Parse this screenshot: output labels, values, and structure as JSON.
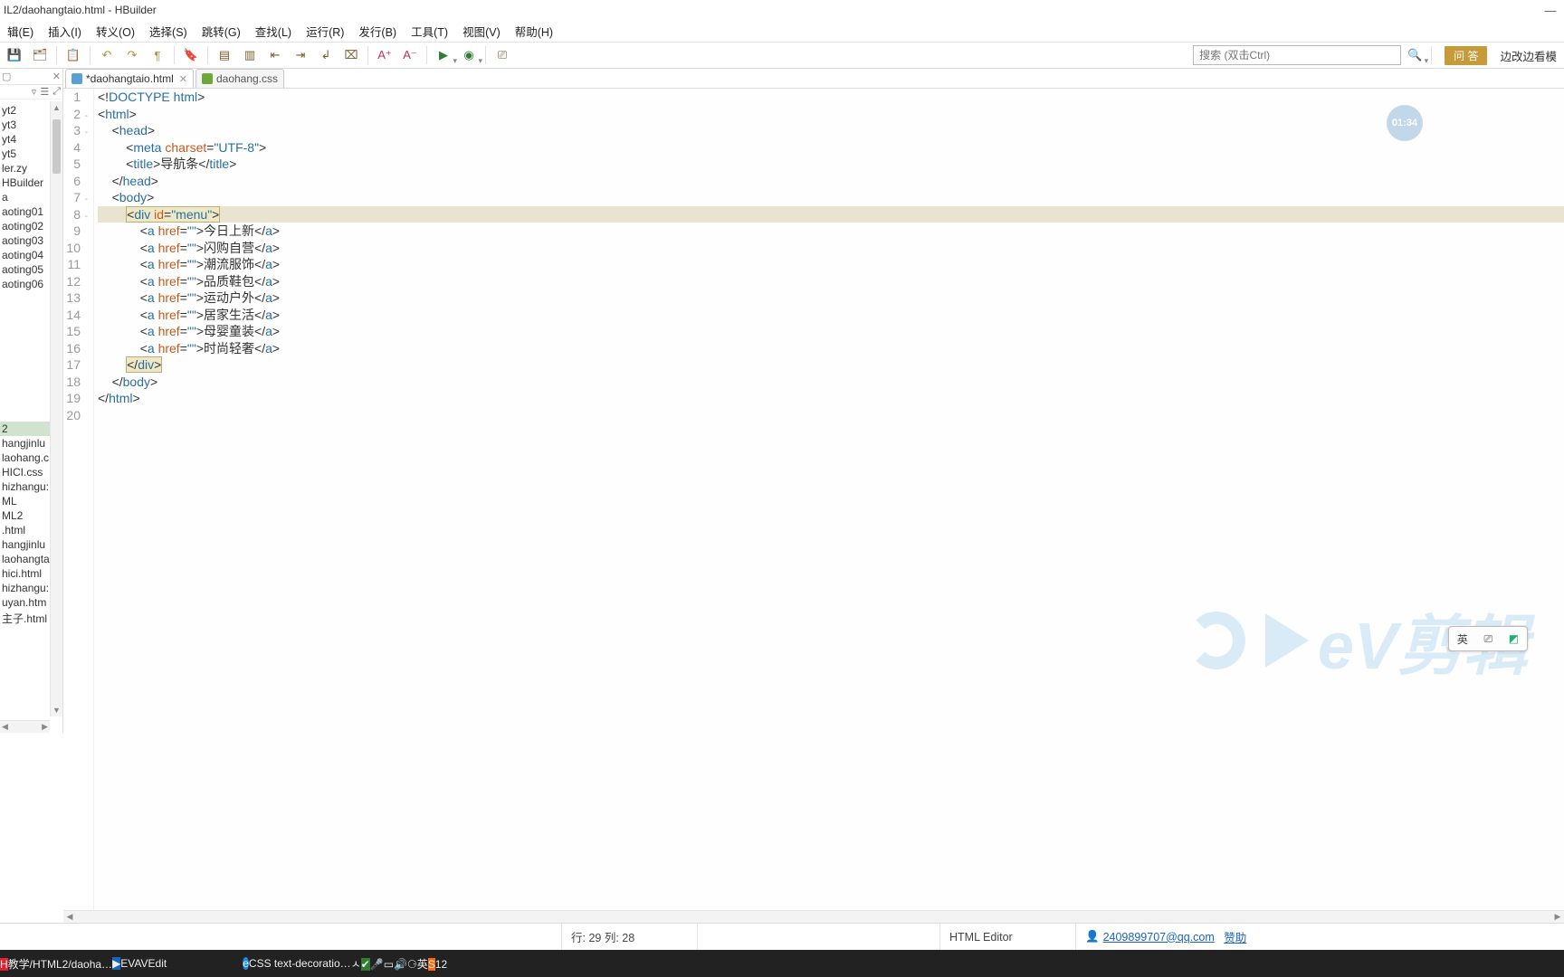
{
  "title": "IL2/daohangtaio.html  -  HBuilder",
  "window": {
    "min": "—",
    "close": "✕"
  },
  "menu": [
    "辑(E)",
    "插入(I)",
    "转义(O)",
    "选择(S)",
    "跳转(G)",
    "查找(L)",
    "运行(R)",
    "发行(B)",
    "工具(T)",
    "视图(V)",
    "帮助(H)"
  ],
  "toolbarSearchPlaceholder": "搜索 (双击Ctrl)",
  "qa": "问 答",
  "previewText": "边改边看模",
  "sidepanel": {
    "head_x": "✕",
    "icons": [
      "▿",
      "☰",
      "⤢"
    ],
    "items": [
      "yt2",
      "yt3",
      "yt4",
      "yt5",
      "ler.zy",
      "HBuilder",
      "a",
      "aoting01",
      "aoting02",
      "aoting03",
      "aoting04",
      "aoting05",
      "aoting06"
    ],
    "selected": "2",
    "items2": [
      "hangjinlu",
      "laohang.c",
      "HICI.css",
      "hizhangu:",
      "ML",
      "ML2",
      ".html",
      "hangjinlu",
      "laohangta",
      "hici.html",
      "hizhangu:",
      "uyan.htm",
      "主子.html"
    ]
  },
  "tabs": [
    {
      "label": "*daohangtaio.html",
      "active": true,
      "modified": true,
      "type": "html"
    },
    {
      "label": "daohang.css",
      "active": false,
      "modified": false,
      "type": "css"
    }
  ],
  "status": {
    "pos": "行: 29  列: 28",
    "editor": "HTML Editor",
    "email": "2409899707@qq.com",
    "sponsor": "赞助"
  },
  "badge": "01:34",
  "ime": {
    "lang": "英",
    "opt": "▾"
  },
  "watermark": "eV剪辑",
  "taskbar": {
    "items": [
      {
        "icon": "h",
        "label": "教学/HTML2/daoha…",
        "active": true
      },
      {
        "icon": "b",
        "label": "EVAVEdit",
        "active": false
      },
      {
        "icon": "",
        "label": "",
        "active": true,
        "blank": true
      },
      {
        "icon": "e",
        "label": "CSS text-decoratio…",
        "active": false
      }
    ],
    "tray": {
      "caret": "ㅅ",
      "ime1": "英",
      "time": "12"
    }
  },
  "code": {
    "lines": [
      {
        "n": "1",
        "fold": "",
        "html": "<span class='k-punc'>&lt;!</span><span class='k-doct'>DOCTYPE</span> <span class='k-tag'>html</span><span class='k-punc'>&gt;</span>"
      },
      {
        "n": "2",
        "fold": "-",
        "html": "<span class='k-punc'>&lt;</span><span class='k-tag'>html</span><span class='k-punc'>&gt;</span>"
      },
      {
        "n": "3",
        "fold": "-",
        "html": "    <span class='k-punc'>&lt;</span><span class='k-tag'>head</span><span class='k-punc'>&gt;</span>"
      },
      {
        "n": "4",
        "fold": "",
        "html": "        <span class='k-punc'>&lt;</span><span class='k-tag'>meta</span> <span class='k-attr'>charset</span><span class='k-punc'>=</span><span class='k-str'>\"UTF-8\"</span><span class='k-punc'>&gt;</span>"
      },
      {
        "n": "5",
        "fold": "",
        "html": "        <span class='k-punc'>&lt;</span><span class='k-tag'>title</span><span class='k-punc'>&gt;</span><span class='k-text'>导航条</span><span class='k-punc'>&lt;/</span><span class='k-tag'>title</span><span class='k-punc'>&gt;</span>"
      },
      {
        "n": "6",
        "fold": "",
        "html": "    <span class='k-punc'>&lt;/</span><span class='k-tag'>head</span><span class='k-punc'>&gt;</span>"
      },
      {
        "n": "7",
        "fold": "-",
        "html": "    <span class='k-punc'>&lt;</span><span class='k-tag'>body</span><span class='k-punc'>&gt;</span>"
      },
      {
        "n": "8",
        "fold": "-",
        "hl": true,
        "html": "        <span class='hlbox1'><span class='k-punc'>&lt;</span><span class='k-tag'>div</span> <span class='k-attr'>id</span><span class='k-punc'>=</span><span class='k-str'>\"menu\"</span><span class='k-punc'>&gt;</span></span>"
      },
      {
        "n": "9",
        "fold": "",
        "html": "            <span class='k-punc'>&lt;</span><span class='k-tag'>a</span> <span class='k-attr'>href</span><span class='k-punc'>=</span><span class='k-str'>\"\"</span><span class='k-punc'>&gt;</span><span class='k-text'>今日上新</span><span class='k-punc'>&lt;/</span><span class='k-tag'>a</span><span class='k-punc'>&gt;</span>"
      },
      {
        "n": "10",
        "fold": "",
        "html": "            <span class='k-punc'>&lt;</span><span class='k-tag'>a</span> <span class='k-attr'>href</span><span class='k-punc'>=</span><span class='k-str'>\"\"</span><span class='k-punc'>&gt;</span><span class='k-text'>闪购自营</span><span class='k-punc'>&lt;/</span><span class='k-tag'>a</span><span class='k-punc'>&gt;</span>"
      },
      {
        "n": "11",
        "fold": "",
        "html": "            <span class='k-punc'>&lt;</span><span class='k-tag'>a</span> <span class='k-attr'>href</span><span class='k-punc'>=</span><span class='k-str'>\"\"</span><span class='k-punc'>&gt;</span><span class='k-text'>潮流服饰</span><span class='k-punc'>&lt;/</span><span class='k-tag'>a</span><span class='k-punc'>&gt;</span>"
      },
      {
        "n": "12",
        "fold": "",
        "html": "            <span class='k-punc'>&lt;</span><span class='k-tag'>a</span> <span class='k-attr'>href</span><span class='k-punc'>=</span><span class='k-str'>\"\"</span><span class='k-punc'>&gt;</span><span class='k-text'>品质鞋包</span><span class='k-punc'>&lt;/</span><span class='k-tag'>a</span><span class='k-punc'>&gt;</span>"
      },
      {
        "n": "13",
        "fold": "",
        "html": "            <span class='k-punc'>&lt;</span><span class='k-tag'>a</span> <span class='k-attr'>href</span><span class='k-punc'>=</span><span class='k-str'>\"\"</span><span class='k-punc'>&gt;</span><span class='k-text'>运动户外</span><span class='k-punc'>&lt;/</span><span class='k-tag'>a</span><span class='k-punc'>&gt;</span>"
      },
      {
        "n": "14",
        "fold": "",
        "html": "            <span class='k-punc'>&lt;</span><span class='k-tag'>a</span> <span class='k-attr'>href</span><span class='k-punc'>=</span><span class='k-str'>\"\"</span><span class='k-punc'>&gt;</span><span class='k-text'>居家生活</span><span class='k-punc'>&lt;/</span><span class='k-tag'>a</span><span class='k-punc'>&gt;</span>"
      },
      {
        "n": "15",
        "fold": "",
        "html": "            <span class='k-punc'>&lt;</span><span class='k-tag'>a</span> <span class='k-attr'>href</span><span class='k-punc'>=</span><span class='k-str'>\"\"</span><span class='k-punc'>&gt;</span><span class='k-text'>母婴童装</span><span class='k-punc'>&lt;/</span><span class='k-tag'>a</span><span class='k-punc'>&gt;</span>"
      },
      {
        "n": "16",
        "fold": "",
        "html": "            <span class='k-punc'>&lt;</span><span class='k-tag'>a</span> <span class='k-attr'>href</span><span class='k-punc'>=</span><span class='k-str'>\"\"</span><span class='k-punc'>&gt;</span><span class='k-text'>时尚轻奢</span><span class='k-punc'>&lt;/</span><span class='k-tag'>a</span><span class='k-punc'>&gt;</span>"
      },
      {
        "n": "17",
        "fold": "",
        "html": "        <span class='hlbox2'><span class='k-punc'>&lt;/</span><span class='k-tag'>div</span><span class='k-punc'>&gt;</span></span>"
      },
      {
        "n": "18",
        "fold": "",
        "html": "    <span class='k-punc'>&lt;/</span><span class='k-tag'>body</span><span class='k-punc'>&gt;</span>"
      },
      {
        "n": "19",
        "fold": "",
        "html": "<span class='k-punc'>&lt;/</span><span class='k-tag'>html</span><span class='k-punc'>&gt;</span>"
      },
      {
        "n": "20",
        "fold": "",
        "html": ""
      }
    ]
  }
}
